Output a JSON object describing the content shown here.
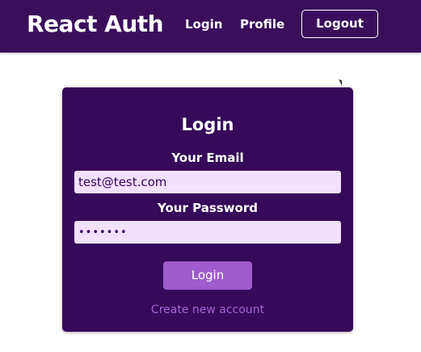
{
  "header": {
    "logo": "React Auth",
    "nav": {
      "login": "Login",
      "profile": "Profile",
      "logout": "Logout"
    }
  },
  "login_card": {
    "title": "Login",
    "email_label": "Your Email",
    "email_value": "test@test.com",
    "password_label": "Your Password",
    "password_value": "•••••••",
    "submit_label": "Login",
    "toggle_label": "Create new account"
  },
  "colors": {
    "header_bg": "#3b0e5c",
    "card_bg": "#36095a",
    "input_bg": "#f1e1fc",
    "button_bg": "#9f5ccc",
    "link_color": "#a763d4"
  }
}
